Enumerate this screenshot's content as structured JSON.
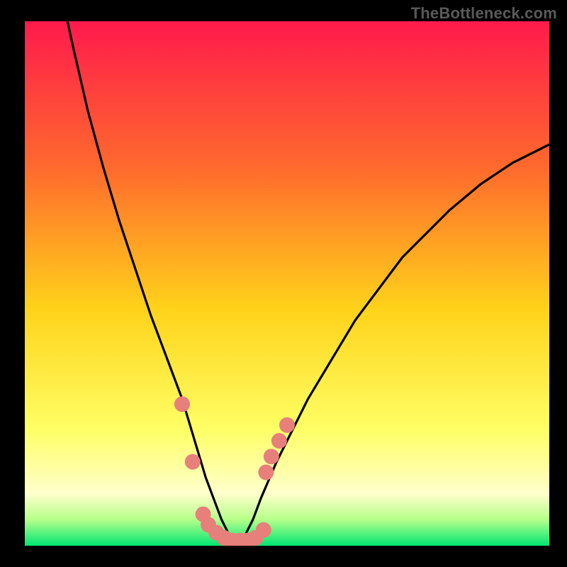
{
  "watermark": "TheBottleneck.com",
  "colors": {
    "frame": "#000000",
    "gradient_top": "#ff1a4c",
    "gradient_mid_upper": "#ff6a2d",
    "gradient_mid": "#ffd31a",
    "gradient_lower": "#ffff66",
    "gradient_pale": "#ffffcc",
    "gradient_green_light": "#b6ff8a",
    "gradient_green": "#00e673",
    "curve": "#000000",
    "dots": "#e77f7b"
  },
  "chart_data": {
    "type": "line",
    "title": "",
    "xlabel": "",
    "ylabel": "",
    "xlim": [
      0,
      100
    ],
    "ylim": [
      0,
      100
    ],
    "curve": {
      "x": [
        0,
        3,
        6,
        9,
        12,
        15,
        18,
        21,
        24,
        27,
        30,
        31.5,
        33,
        34.5,
        36,
        37.5,
        39,
        40.5,
        42,
        43.5,
        45,
        48,
        51,
        54,
        57,
        60,
        63,
        66,
        69,
        72,
        75,
        78,
        81,
        84,
        87,
        90,
        93,
        96,
        99,
        100
      ],
      "y": [
        150,
        130,
        110,
        96,
        83,
        72,
        62,
        53,
        44,
        36,
        28,
        23,
        18,
        13,
        9,
        5,
        2,
        0.5,
        2,
        5,
        9,
        16,
        22,
        28,
        33,
        38,
        43,
        47,
        51,
        55,
        58,
        61,
        64,
        66.5,
        69,
        71,
        73,
        74.5,
        76,
        76.5
      ]
    },
    "dots": [
      {
        "x": 30.0,
        "y": 27
      },
      {
        "x": 32.0,
        "y": 16
      },
      {
        "x": 34.0,
        "y": 6
      },
      {
        "x": 35.0,
        "y": 4
      },
      {
        "x": 36.5,
        "y": 2.5
      },
      {
        "x": 38.0,
        "y": 1.5
      },
      {
        "x": 39.5,
        "y": 1
      },
      {
        "x": 41.0,
        "y": 1
      },
      {
        "x": 42.5,
        "y": 1
      },
      {
        "x": 44.0,
        "y": 1.5
      },
      {
        "x": 45.5,
        "y": 3
      },
      {
        "x": 46.0,
        "y": 14
      },
      {
        "x": 47.0,
        "y": 17
      },
      {
        "x": 48.5,
        "y": 20
      },
      {
        "x": 50.0,
        "y": 23
      }
    ]
  }
}
